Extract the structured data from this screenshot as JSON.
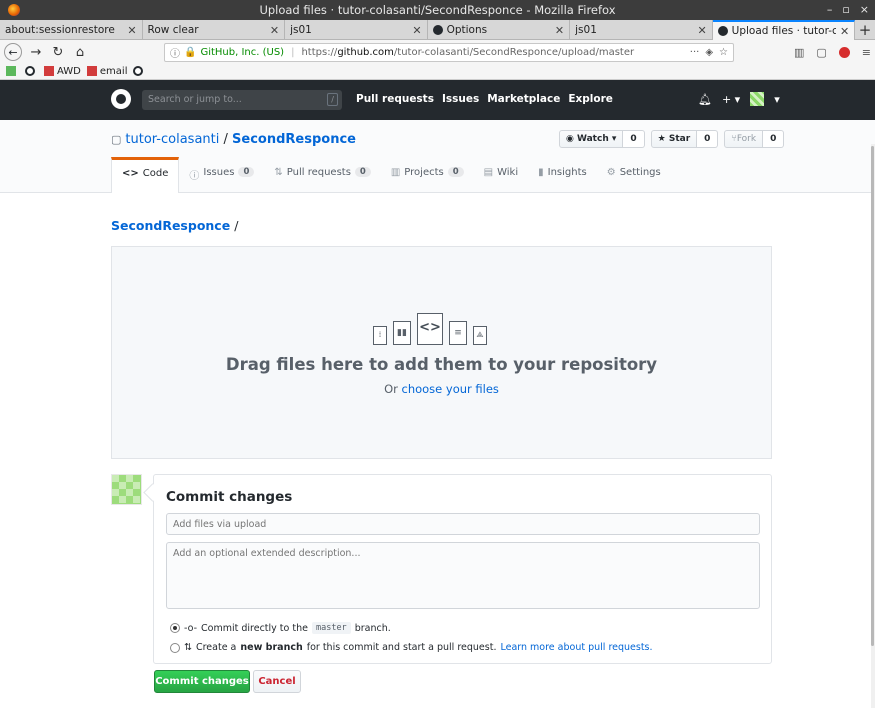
{
  "window": {
    "title": "Upload files · tutor-colasanti/SecondResponce - Mozilla Firefox",
    "controls": [
      "–",
      "▫",
      "×"
    ]
  },
  "tabs": [
    {
      "label": "about:sessionrestore",
      "icon": false
    },
    {
      "label": "Row clear",
      "icon": false
    },
    {
      "label": "js01",
      "icon": false
    },
    {
      "label": "Options",
      "icon": true
    },
    {
      "label": "js01",
      "icon": false
    },
    {
      "label": "Upload files · tutor-col",
      "icon": true
    }
  ],
  "navbar": {
    "ev_org": "GitHub, Inc. (US)",
    "url_prefix": "https://",
    "url_domain": "github.com",
    "url_path": "/tutor-colasanti/SecondResponce/upload/master"
  },
  "bookmarks": [
    {
      "label": "",
      "icon": "bm-green"
    },
    {
      "label": "",
      "icon": "bm-gh"
    },
    {
      "label": "AWD",
      "icon": "bm-red"
    },
    {
      "label": "email",
      "icon": "bm-red"
    },
    {
      "label": "",
      "icon": "bm-gh"
    }
  ],
  "github": {
    "search_placeholder": "Search or jump to...",
    "search_key": "/",
    "nav": [
      "Pull requests",
      "Issues",
      "Marketplace",
      "Explore"
    ],
    "owner": "tutor-colasanti",
    "repo": "SecondResponce",
    "watch": {
      "label": "Watch ▾",
      "count": "0"
    },
    "star": {
      "label": "★ Star",
      "count": "0"
    },
    "fork": {
      "label": "Fork",
      "count": "0"
    },
    "reponav": [
      {
        "label": "Code",
        "icon": "<>",
        "count": ""
      },
      {
        "label": "Issues",
        "icon": "ⓘ",
        "count": "0"
      },
      {
        "label": "Pull requests",
        "icon": "⇅",
        "count": "0"
      },
      {
        "label": "Projects",
        "icon": "▥",
        "count": "0"
      },
      {
        "label": "Wiki",
        "icon": "▤",
        "count": ""
      },
      {
        "label": "Insights",
        "icon": "▮",
        "count": ""
      },
      {
        "label": "Settings",
        "icon": "⚙",
        "count": ""
      }
    ]
  },
  "upload": {
    "breadcrumb_repo": "SecondResponce",
    "breadcrumb_sep": "/",
    "drop_title": "Drag files here to add them to your repository",
    "drop_sub_prefix": "Or",
    "drop_sub_link": "choose your files"
  },
  "commit": {
    "title": "Commit changes",
    "summary_placeholder": "Add files via upload",
    "description_placeholder": "Add an optional extended description...",
    "option_direct_prefix": "Commit directly to the",
    "option_direct_branch": "master",
    "option_direct_suffix": "branch.",
    "option_new_prefix": "Create a",
    "option_new_bold": "new branch",
    "option_new_suffix": "for this commit and start a pull request.",
    "option_new_link": "Learn more about pull requests.",
    "submit_label": "Commit changes",
    "cancel_label": "Cancel"
  }
}
